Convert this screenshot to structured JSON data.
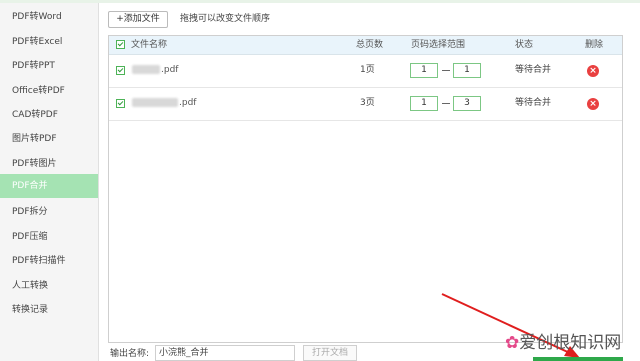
{
  "sidebar": {
    "items": [
      {
        "label": "PDF转Word"
      },
      {
        "label": "PDF转Excel"
      },
      {
        "label": "PDF转PPT"
      },
      {
        "label": "Office转PDF"
      },
      {
        "label": "CAD转PDF"
      },
      {
        "label": "图片转PDF"
      },
      {
        "label": "PDF转图片"
      },
      {
        "label": "PDF合并",
        "active": true
      },
      {
        "label": "PDF拆分"
      },
      {
        "label": "PDF压缩"
      },
      {
        "label": "PDF转扫描件"
      },
      {
        "label": "人工转换"
      },
      {
        "label": "转换记录"
      }
    ]
  },
  "toolbar": {
    "add_label": "+添加文件",
    "hint": "拖拽可以改变文件顺序"
  },
  "table": {
    "headers": {
      "name": "文件名称",
      "pages": "总页数",
      "range": "页码选择范围",
      "status": "状态",
      "delete": "删除"
    },
    "rows": [
      {
        "name": ".pdf",
        "pages": "1页",
        "from": "1",
        "to": "1",
        "status": "等待合并"
      },
      {
        "name": ".pdf",
        "pages": "3页",
        "from": "1",
        "to": "3",
        "status": "等待合并"
      }
    ]
  },
  "output": {
    "label": "输出名称:",
    "value": "小浣熊_合并",
    "open_label": "打开文档"
  },
  "watermark": {
    "text": "爱创根知识网"
  },
  "colors": {
    "accent": "#a5e3b3",
    "delete": "#e94040",
    "checkbox": "#4db357"
  }
}
